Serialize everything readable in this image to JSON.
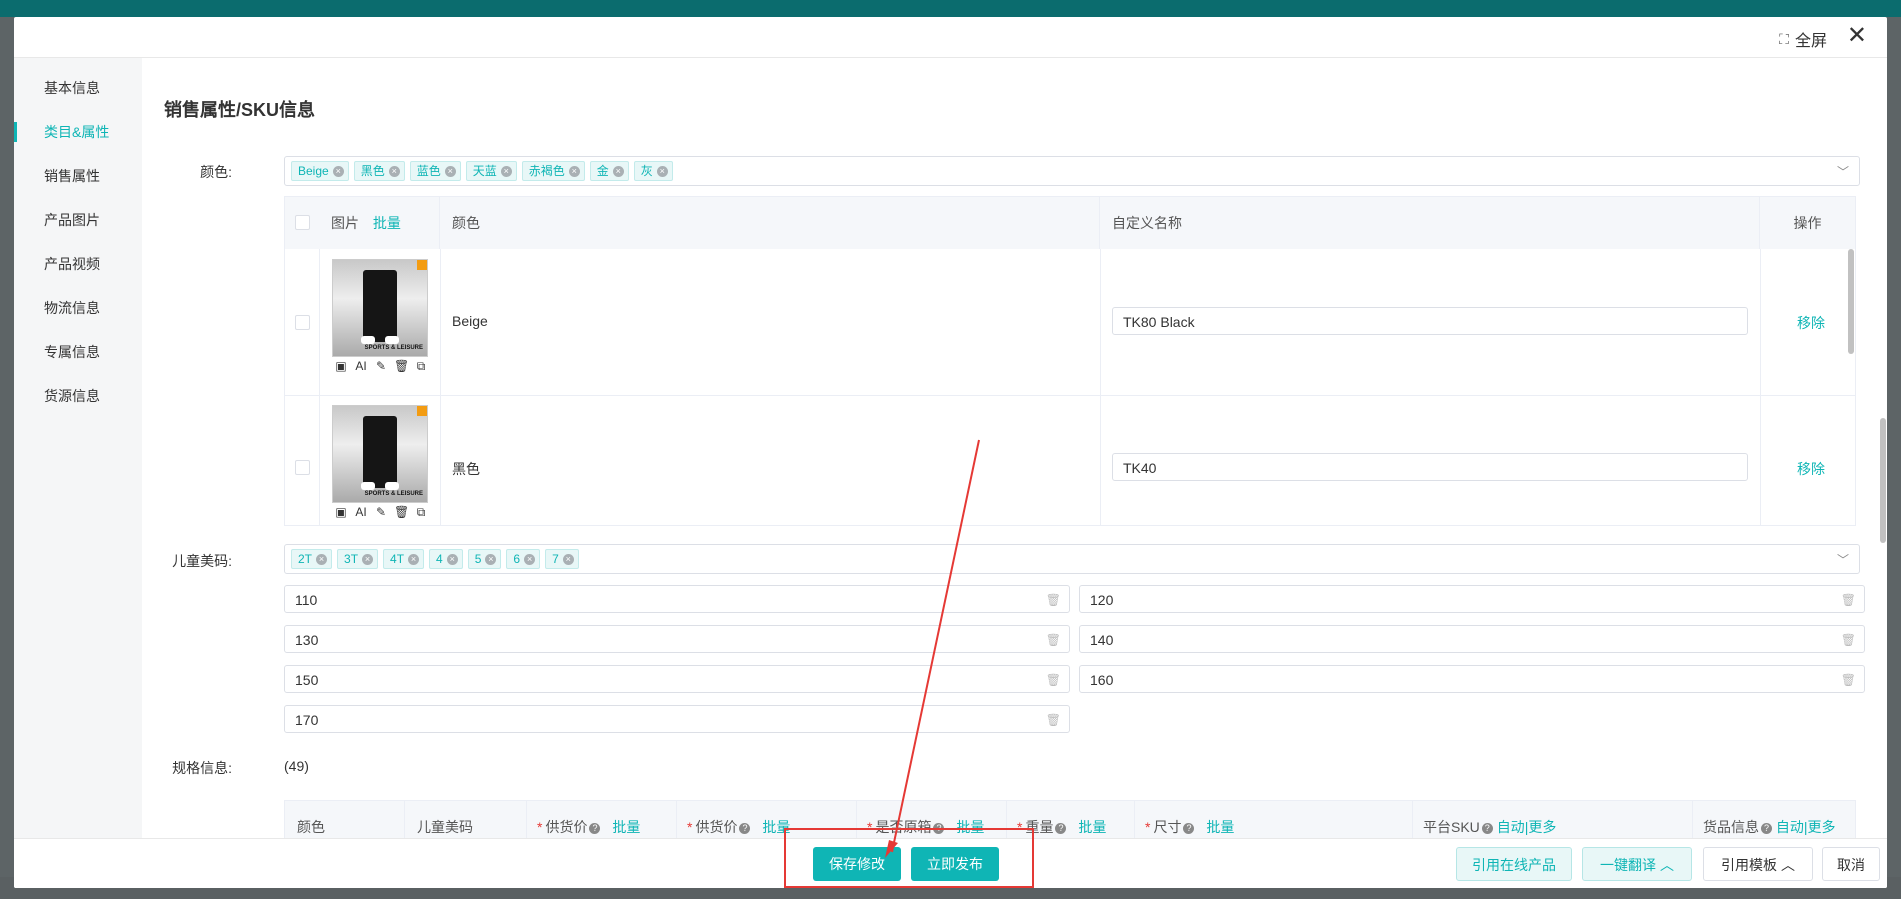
{
  "header": {
    "fullscreen_label": "全屏",
    "close_symbol": "✕"
  },
  "sidebar": {
    "items": [
      {
        "label": "基本信息"
      },
      {
        "label": "类目&属性"
      },
      {
        "label": "销售属性"
      },
      {
        "label": "产品图片"
      },
      {
        "label": "产品视频"
      },
      {
        "label": "物流信息"
      },
      {
        "label": "专属信息"
      },
      {
        "label": "货源信息"
      }
    ],
    "active_index": 1
  },
  "main": {
    "section_title": "销售属性/SKU信息",
    "color_label": "颜色:",
    "color_tags": [
      "Beige",
      "黑色",
      "蓝色",
      "天蓝",
      "赤褐色",
      "金",
      "灰"
    ],
    "table": {
      "headers": {
        "image": "图片",
        "batch": "批量",
        "color": "颜色",
        "custom_name": "自定义名称",
        "action": "操作"
      },
      "rows": [
        {
          "color": "Beige",
          "custom_name": "TK80 Black",
          "action": "移除"
        },
        {
          "color": "黑色",
          "custom_name": "TK40",
          "action": "移除"
        }
      ],
      "thumb_toolbar": {
        "ai": "AI"
      },
      "thumb_badge": "SPORTS & LEISURE"
    },
    "size_label": "儿童美码:",
    "size_tags": [
      "2T",
      "3T",
      "4T",
      "4",
      "5",
      "6",
      "7"
    ],
    "size_values": [
      "110",
      "120",
      "130",
      "140",
      "150",
      "160",
      "170"
    ],
    "spec_label": "规格信息:",
    "spec_count": "(49)",
    "spec_headers": {
      "color": "颜色",
      "size": "儿童美码",
      "supply_price_1": "供货价",
      "supply_price_2": "供货价",
      "original_box": "是否原箱",
      "weight": "重量",
      "dimension": "尺寸",
      "platform_sku": "平台SKU",
      "goods_info": "货品信息",
      "batch": "批量",
      "auto": "自动",
      "more": "更多",
      "separator": "|"
    }
  },
  "footer": {
    "save": "保存修改",
    "publish": "立即发布",
    "quote_online": "引用在线产品",
    "translate": "一键翻译",
    "template": "引用模板",
    "cancel": "取消"
  },
  "colors": {
    "accent": "#0fb5b5",
    "annotation": "#e53935"
  }
}
